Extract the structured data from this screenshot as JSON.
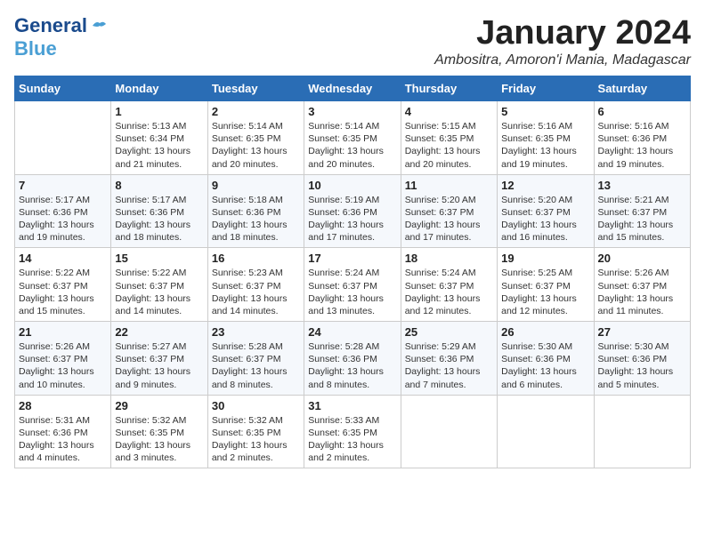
{
  "header": {
    "logo_line1": "General",
    "logo_line2": "Blue",
    "month": "January 2024",
    "location": "Ambositra, Amoron'i Mania, Madagascar"
  },
  "weekdays": [
    "Sunday",
    "Monday",
    "Tuesday",
    "Wednesday",
    "Thursday",
    "Friday",
    "Saturday"
  ],
  "weeks": [
    [
      {
        "day": "",
        "sunrise": "",
        "sunset": "",
        "daylight": ""
      },
      {
        "day": "1",
        "sunrise": "Sunrise: 5:13 AM",
        "sunset": "Sunset: 6:34 PM",
        "daylight": "Daylight: 13 hours and 21 minutes."
      },
      {
        "day": "2",
        "sunrise": "Sunrise: 5:14 AM",
        "sunset": "Sunset: 6:35 PM",
        "daylight": "Daylight: 13 hours and 20 minutes."
      },
      {
        "day": "3",
        "sunrise": "Sunrise: 5:14 AM",
        "sunset": "Sunset: 6:35 PM",
        "daylight": "Daylight: 13 hours and 20 minutes."
      },
      {
        "day": "4",
        "sunrise": "Sunrise: 5:15 AM",
        "sunset": "Sunset: 6:35 PM",
        "daylight": "Daylight: 13 hours and 20 minutes."
      },
      {
        "day": "5",
        "sunrise": "Sunrise: 5:16 AM",
        "sunset": "Sunset: 6:35 PM",
        "daylight": "Daylight: 13 hours and 19 minutes."
      },
      {
        "day": "6",
        "sunrise": "Sunrise: 5:16 AM",
        "sunset": "Sunset: 6:36 PM",
        "daylight": "Daylight: 13 hours and 19 minutes."
      }
    ],
    [
      {
        "day": "7",
        "sunrise": "Sunrise: 5:17 AM",
        "sunset": "Sunset: 6:36 PM",
        "daylight": "Daylight: 13 hours and 19 minutes."
      },
      {
        "day": "8",
        "sunrise": "Sunrise: 5:17 AM",
        "sunset": "Sunset: 6:36 PM",
        "daylight": "Daylight: 13 hours and 18 minutes."
      },
      {
        "day": "9",
        "sunrise": "Sunrise: 5:18 AM",
        "sunset": "Sunset: 6:36 PM",
        "daylight": "Daylight: 13 hours and 18 minutes."
      },
      {
        "day": "10",
        "sunrise": "Sunrise: 5:19 AM",
        "sunset": "Sunset: 6:36 PM",
        "daylight": "Daylight: 13 hours and 17 minutes."
      },
      {
        "day": "11",
        "sunrise": "Sunrise: 5:20 AM",
        "sunset": "Sunset: 6:37 PM",
        "daylight": "Daylight: 13 hours and 17 minutes."
      },
      {
        "day": "12",
        "sunrise": "Sunrise: 5:20 AM",
        "sunset": "Sunset: 6:37 PM",
        "daylight": "Daylight: 13 hours and 16 minutes."
      },
      {
        "day": "13",
        "sunrise": "Sunrise: 5:21 AM",
        "sunset": "Sunset: 6:37 PM",
        "daylight": "Daylight: 13 hours and 15 minutes."
      }
    ],
    [
      {
        "day": "14",
        "sunrise": "Sunrise: 5:22 AM",
        "sunset": "Sunset: 6:37 PM",
        "daylight": "Daylight: 13 hours and 15 minutes."
      },
      {
        "day": "15",
        "sunrise": "Sunrise: 5:22 AM",
        "sunset": "Sunset: 6:37 PM",
        "daylight": "Daylight: 13 hours and 14 minutes."
      },
      {
        "day": "16",
        "sunrise": "Sunrise: 5:23 AM",
        "sunset": "Sunset: 6:37 PM",
        "daylight": "Daylight: 13 hours and 14 minutes."
      },
      {
        "day": "17",
        "sunrise": "Sunrise: 5:24 AM",
        "sunset": "Sunset: 6:37 PM",
        "daylight": "Daylight: 13 hours and 13 minutes."
      },
      {
        "day": "18",
        "sunrise": "Sunrise: 5:24 AM",
        "sunset": "Sunset: 6:37 PM",
        "daylight": "Daylight: 13 hours and 12 minutes."
      },
      {
        "day": "19",
        "sunrise": "Sunrise: 5:25 AM",
        "sunset": "Sunset: 6:37 PM",
        "daylight": "Daylight: 13 hours and 12 minutes."
      },
      {
        "day": "20",
        "sunrise": "Sunrise: 5:26 AM",
        "sunset": "Sunset: 6:37 PM",
        "daylight": "Daylight: 13 hours and 11 minutes."
      }
    ],
    [
      {
        "day": "21",
        "sunrise": "Sunrise: 5:26 AM",
        "sunset": "Sunset: 6:37 PM",
        "daylight": "Daylight: 13 hours and 10 minutes."
      },
      {
        "day": "22",
        "sunrise": "Sunrise: 5:27 AM",
        "sunset": "Sunset: 6:37 PM",
        "daylight": "Daylight: 13 hours and 9 minutes."
      },
      {
        "day": "23",
        "sunrise": "Sunrise: 5:28 AM",
        "sunset": "Sunset: 6:37 PM",
        "daylight": "Daylight: 13 hours and 8 minutes."
      },
      {
        "day": "24",
        "sunrise": "Sunrise: 5:28 AM",
        "sunset": "Sunset: 6:36 PM",
        "daylight": "Daylight: 13 hours and 8 minutes."
      },
      {
        "day": "25",
        "sunrise": "Sunrise: 5:29 AM",
        "sunset": "Sunset: 6:36 PM",
        "daylight": "Daylight: 13 hours and 7 minutes."
      },
      {
        "day": "26",
        "sunrise": "Sunrise: 5:30 AM",
        "sunset": "Sunset: 6:36 PM",
        "daylight": "Daylight: 13 hours and 6 minutes."
      },
      {
        "day": "27",
        "sunrise": "Sunrise: 5:30 AM",
        "sunset": "Sunset: 6:36 PM",
        "daylight": "Daylight: 13 hours and 5 minutes."
      }
    ],
    [
      {
        "day": "28",
        "sunrise": "Sunrise: 5:31 AM",
        "sunset": "Sunset: 6:36 PM",
        "daylight": "Daylight: 13 hours and 4 minutes."
      },
      {
        "day": "29",
        "sunrise": "Sunrise: 5:32 AM",
        "sunset": "Sunset: 6:35 PM",
        "daylight": "Daylight: 13 hours and 3 minutes."
      },
      {
        "day": "30",
        "sunrise": "Sunrise: 5:32 AM",
        "sunset": "Sunset: 6:35 PM",
        "daylight": "Daylight: 13 hours and 2 minutes."
      },
      {
        "day": "31",
        "sunrise": "Sunrise: 5:33 AM",
        "sunset": "Sunset: 6:35 PM",
        "daylight": "Daylight: 13 hours and 2 minutes."
      },
      {
        "day": "",
        "sunrise": "",
        "sunset": "",
        "daylight": ""
      },
      {
        "day": "",
        "sunrise": "",
        "sunset": "",
        "daylight": ""
      },
      {
        "day": "",
        "sunrise": "",
        "sunset": "",
        "daylight": ""
      }
    ]
  ]
}
